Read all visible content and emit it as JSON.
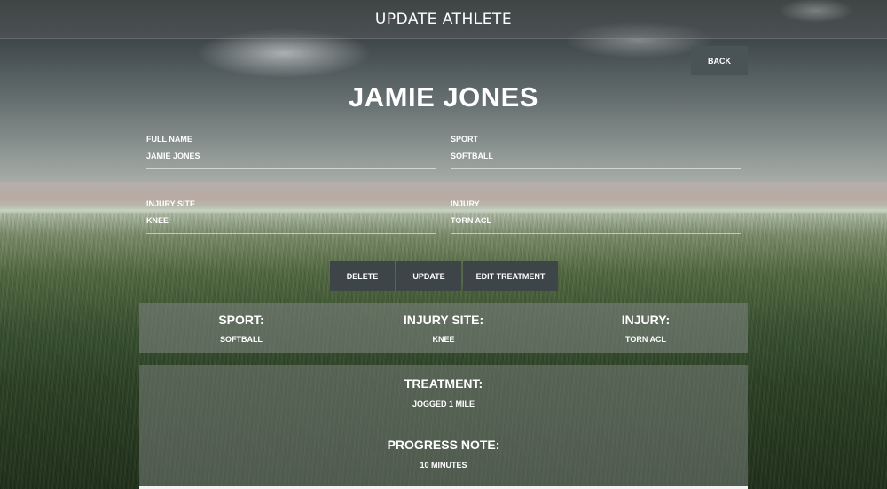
{
  "header": {
    "title": "UPDATE ATHLETE"
  },
  "back_label": "BACK",
  "athlete": {
    "display_name": "JAMIE JONES"
  },
  "form": {
    "full_name": {
      "label": "FULL NAME",
      "value": "JAMIE JONES"
    },
    "sport": {
      "label": "SPORT",
      "value": "SOFTBALL"
    },
    "injury_site": {
      "label": "INJURY SITE",
      "value": "KNEE"
    },
    "injury": {
      "label": "INJURY",
      "value": "TORN ACL"
    }
  },
  "actions": {
    "delete": "DELETE",
    "update": "UPDATE",
    "edit_treatment": "EDIT TREATMENT"
  },
  "summary": {
    "sport": {
      "heading": "SPORT:",
      "value": "SOFTBALL"
    },
    "injury_site": {
      "heading": "INJURY SITE:",
      "value": "KNEE"
    },
    "injury": {
      "heading": "INJURY:",
      "value": "TORN ACL"
    }
  },
  "treatment": {
    "heading": "TREATMENT:",
    "value": "JOGGED 1 MILE",
    "progress_heading": "PROGRESS NOTE:",
    "progress_value": "10 MINUTES"
  },
  "colors": {
    "button_bg": "#3d4548",
    "back_button_bg": "#4a5457",
    "card_bg": "#78807a"
  }
}
